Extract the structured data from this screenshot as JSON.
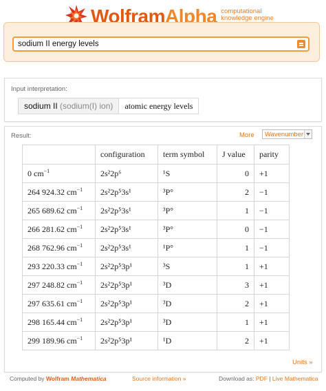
{
  "header": {
    "brand_w": "Wolfram",
    "brand_a": "Alpha",
    "tagline_1": "computational",
    "tagline_2": "knowledge engine"
  },
  "search": {
    "query": "sodium II energy levels"
  },
  "input_pod": {
    "title": "Input interpretation:",
    "term_main": "sodium II",
    "term_sub": "(sodium(I) ion)",
    "term_2": "atomic energy levels"
  },
  "result_pod": {
    "title": "Result:",
    "more_label": "More",
    "unit_select": "Wavenumber",
    "units_link": "Units »",
    "headers": [
      "",
      "configuration",
      "term symbol",
      "J value",
      "parity"
    ],
    "rows": [
      {
        "energy": "0 cm",
        "config": "2s²2p⁶",
        "term": "¹S",
        "j": "0",
        "parity": "+1"
      },
      {
        "energy": "264 924.32 cm",
        "config": "2s²2p⁵3s¹",
        "term": "³P°",
        "j": "2",
        "parity": "−1"
      },
      {
        "energy": "265 689.62 cm",
        "config": "2s²2p⁵3s¹",
        "term": "³P°",
        "j": "1",
        "parity": "−1"
      },
      {
        "energy": "266 281.62 cm",
        "config": "2s²2p⁵3s¹",
        "term": "³P°",
        "j": "0",
        "parity": "−1"
      },
      {
        "energy": "268 762.96 cm",
        "config": "2s²2p⁵3s¹",
        "term": "¹P°",
        "j": "1",
        "parity": "−1"
      },
      {
        "energy": "293 220.33 cm",
        "config": "2s²2p⁵3p¹",
        "term": "³S",
        "j": "1",
        "parity": "+1"
      },
      {
        "energy": "297 248.82 cm",
        "config": "2s²2p⁵3p¹",
        "term": "³D",
        "j": "3",
        "parity": "+1"
      },
      {
        "energy": "297 635.61 cm",
        "config": "2s²2p⁵3p¹",
        "term": "³D",
        "j": "2",
        "parity": "+1"
      },
      {
        "energy": "298 165.44 cm",
        "config": "2s²2p⁵3p¹",
        "term": "³D",
        "j": "1",
        "parity": "+1"
      },
      {
        "energy": "299 189.96 cm",
        "config": "2s²2p⁵3p¹",
        "term": "¹D",
        "j": "2",
        "parity": "+1"
      }
    ],
    "energy_unit_exponent": "−1"
  },
  "footer": {
    "computed_by": "Computed by",
    "wolfram": "Wolfram",
    "mathematica": "Mathematica",
    "source_info": "Source information »",
    "download_as": "Download as:",
    "pdf": "PDF",
    "separator": "|",
    "live_mathematica": "Live Mathematica"
  },
  "colors": {
    "brand": "#e05a12",
    "accent": "#f39a3a",
    "link": "#e8751a"
  },
  "icons": [
    "wolfram-spikey-icon",
    "search-go-icon",
    "dropdown-chevron-icon"
  ]
}
